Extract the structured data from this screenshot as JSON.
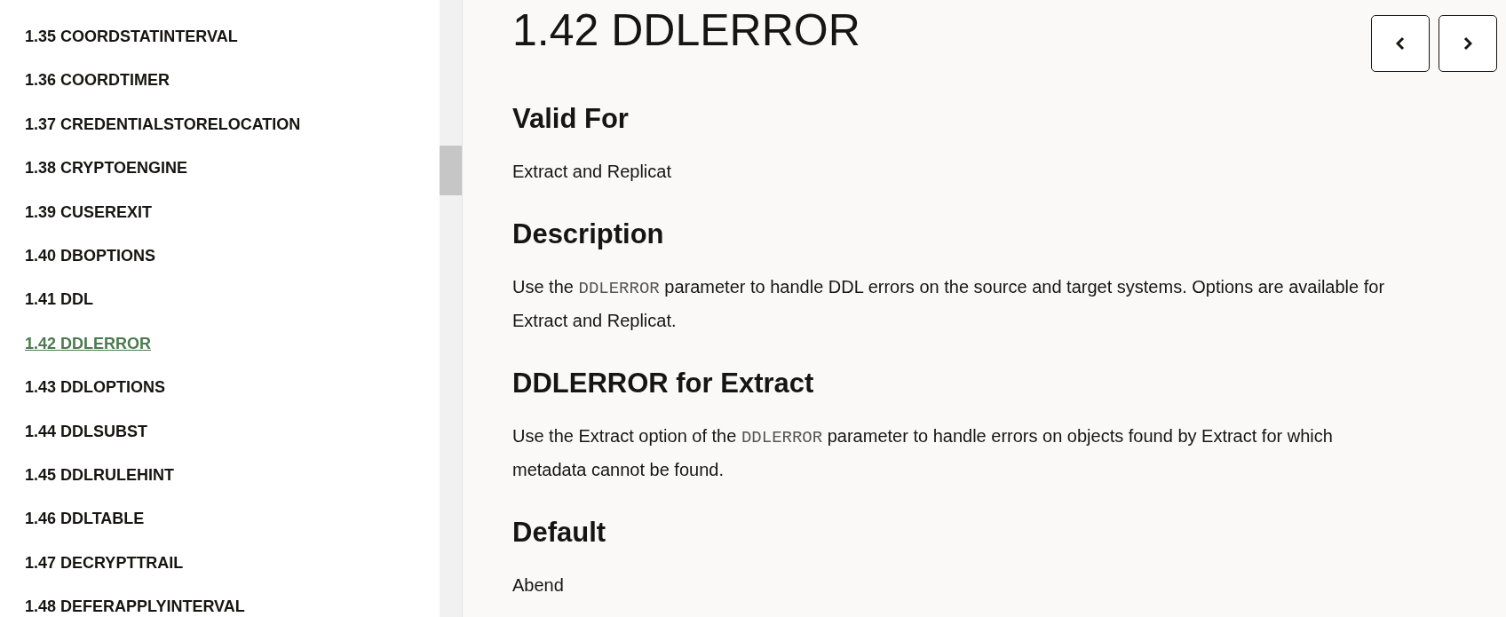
{
  "sidebar": {
    "items": [
      {
        "label": "1.35 COORDSTATINTERVAL",
        "selected": false
      },
      {
        "label": "1.36 COORDTIMER",
        "selected": false
      },
      {
        "label": "1.37 CREDENTIALSTORELOCATION",
        "selected": false
      },
      {
        "label": "1.38 CRYPTOENGINE",
        "selected": false
      },
      {
        "label": "1.39 CUSEREXIT",
        "selected": false
      },
      {
        "label": "1.40 DBOPTIONS",
        "selected": false
      },
      {
        "label": "1.41 DDL",
        "selected": false
      },
      {
        "label": "1.42 DDLERROR",
        "selected": true
      },
      {
        "label": "1.43 DDLOPTIONS",
        "selected": false
      },
      {
        "label": "1.44 DDLSUBST",
        "selected": false
      },
      {
        "label": "1.45 DDLRULEHINT",
        "selected": false
      },
      {
        "label": "1.46 DDLTABLE",
        "selected": false
      },
      {
        "label": "1.47 DECRYPTTRAIL",
        "selected": false
      },
      {
        "label": "1.48 DEFERAPPLYINTERVAL",
        "selected": false
      }
    ]
  },
  "content": {
    "title": "1.42 DDLERROR",
    "nav_buttons": [
      {
        "kind": "previous"
      },
      {
        "kind": "next"
      }
    ],
    "sections": [
      {
        "heading": "Valid For",
        "paragraph": [
          {
            "kind": "text",
            "text": "Extract and Replicat"
          }
        ]
      },
      {
        "heading": "Description",
        "paragraph": [
          {
            "kind": "text",
            "text": "Use the "
          },
          {
            "kind": "code",
            "text": "DDLERROR"
          },
          {
            "kind": "text",
            "text": " parameter to handle DDL errors on the source and target systems. Options are available for Extract and Replicat."
          }
        ]
      },
      {
        "heading": "DDLERROR for Extract",
        "paragraph": [
          {
            "kind": "text",
            "text": "Use the Extract option of the "
          },
          {
            "kind": "code",
            "text": "DDLERROR"
          },
          {
            "kind": "text",
            "text": " parameter to handle errors on objects found by Extract for which metadata cannot be found."
          }
        ]
      },
      {
        "heading": "Default",
        "paragraph": [
          {
            "kind": "text",
            "text": "Abend"
          }
        ]
      }
    ]
  }
}
